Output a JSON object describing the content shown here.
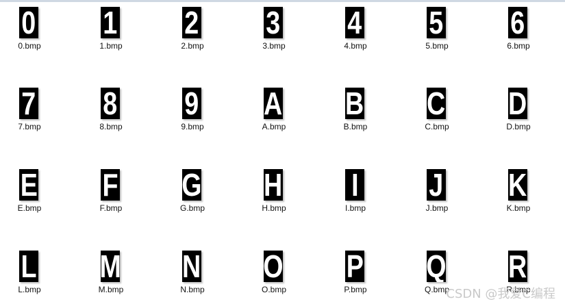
{
  "thumb_color": "#000000",
  "glyph_color": "#ffffff",
  "files": [
    {
      "glyph": "0",
      "label": "0.bmp"
    },
    {
      "glyph": "1",
      "label": "1.bmp"
    },
    {
      "glyph": "2",
      "label": "2.bmp"
    },
    {
      "glyph": "3",
      "label": "3.bmp"
    },
    {
      "glyph": "4",
      "label": "4.bmp"
    },
    {
      "glyph": "5",
      "label": "5.bmp"
    },
    {
      "glyph": "6",
      "label": "6.bmp"
    },
    {
      "glyph": "7",
      "label": "7.bmp"
    },
    {
      "glyph": "8",
      "label": "8.bmp"
    },
    {
      "glyph": "9",
      "label": "9.bmp"
    },
    {
      "glyph": "A",
      "label": "A.bmp"
    },
    {
      "glyph": "B",
      "label": "B.bmp"
    },
    {
      "glyph": "C",
      "label": "C.bmp"
    },
    {
      "glyph": "D",
      "label": "D.bmp"
    },
    {
      "glyph": "E",
      "label": "E.bmp"
    },
    {
      "glyph": "F",
      "label": "F.bmp"
    },
    {
      "glyph": "G",
      "label": "G.bmp"
    },
    {
      "glyph": "H",
      "label": "H.bmp"
    },
    {
      "glyph": "I",
      "label": "I.bmp"
    },
    {
      "glyph": "J",
      "label": "J.bmp"
    },
    {
      "glyph": "K",
      "label": "K.bmp"
    },
    {
      "glyph": "L",
      "label": "L.bmp"
    },
    {
      "glyph": "M",
      "label": "M.bmp"
    },
    {
      "glyph": "N",
      "label": "N.bmp"
    },
    {
      "glyph": "O",
      "label": "O.bmp"
    },
    {
      "glyph": "P",
      "label": "P.bmp"
    },
    {
      "glyph": "Q",
      "label": "Q.bmp"
    },
    {
      "glyph": "R",
      "label": "R.bmp"
    }
  ],
  "watermark": "CSDN @我爱C编程"
}
